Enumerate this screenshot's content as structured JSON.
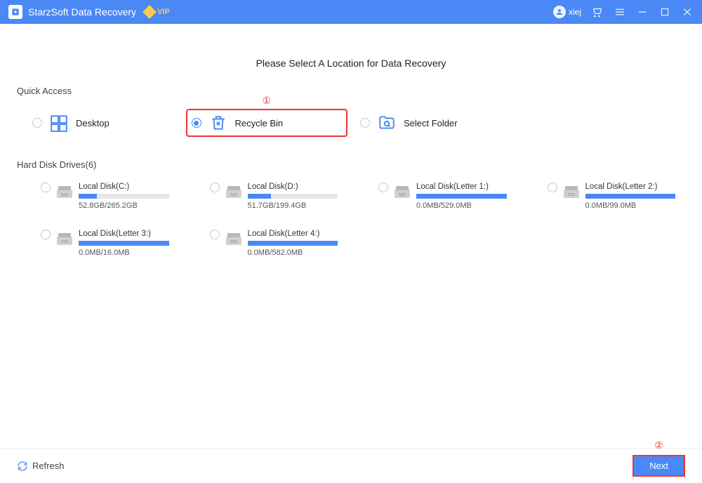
{
  "titlebar": {
    "app_name": "StarzSoft Data Recovery",
    "vip_label": "VIP",
    "username": "xiej"
  },
  "heading": "Please Select A Location for Data Recovery",
  "quick_access": {
    "label": "Quick Access",
    "items": [
      {
        "label": "Desktop",
        "selected": false
      },
      {
        "label": "Recycle Bin",
        "selected": true
      },
      {
        "label": "Select Folder",
        "selected": false
      }
    ]
  },
  "drives_section": {
    "label": "Hard Disk Drives(6)",
    "drives": [
      {
        "name": "Local Disk(C:)",
        "used": "52.8GB",
        "total": "265.2GB",
        "pct": 20
      },
      {
        "name": "Local Disk(D:)",
        "used": "51.7GB",
        "total": "199.4GB",
        "pct": 26
      },
      {
        "name": "Local Disk(Letter 1:)",
        "used": "0.0MB",
        "total": "529.0MB",
        "pct": 100
      },
      {
        "name": "Local Disk(Letter 2:)",
        "used": "0.0MB",
        "total": "99.0MB",
        "pct": 100
      },
      {
        "name": "Local Disk(Letter 3:)",
        "used": "0.0MB",
        "total": "16.0MB",
        "pct": 100
      },
      {
        "name": "Local Disk(Letter 4:)",
        "used": "0.0MB",
        "total": "582.0MB",
        "pct": 100
      }
    ]
  },
  "footer": {
    "refresh": "Refresh",
    "next": "Next"
  },
  "callouts": {
    "one": "①",
    "two": "②"
  }
}
